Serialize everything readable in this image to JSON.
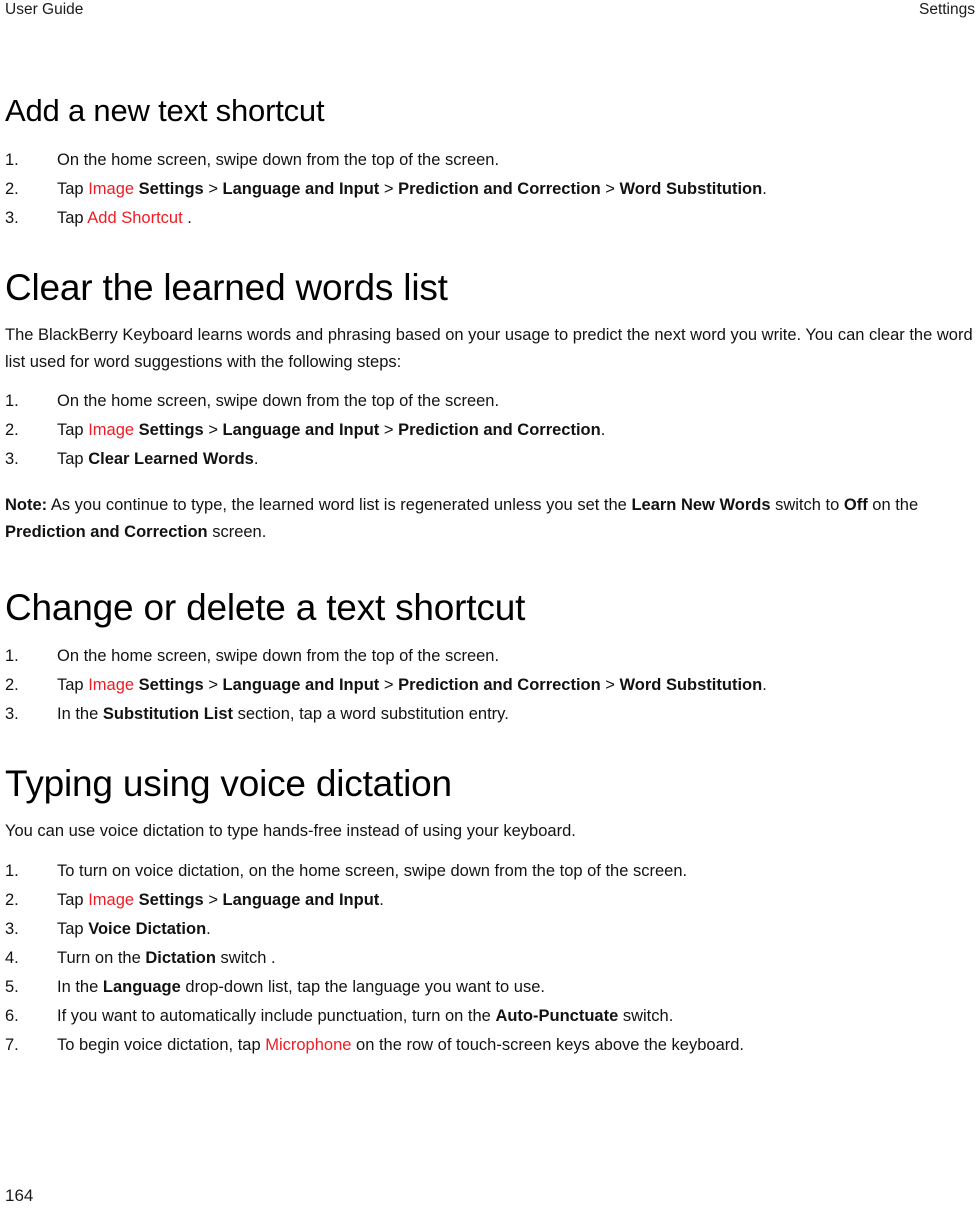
{
  "header": {
    "left": "User Guide",
    "right": "Settings"
  },
  "footer": {
    "page_number": "164"
  },
  "colors": {
    "link_red": "#ee1c25",
    "text": "#121212",
    "background": "#ffffff"
  },
  "sections": [
    {
      "id": "add-a-new-text-shortcut",
      "title": "Add a new text shortcut",
      "steps": [
        {
          "number": "1.",
          "parts": [
            {
              "text": "On the home screen, swipe down from the top of the screen.",
              "style": "normal"
            }
          ]
        },
        {
          "number": "2.",
          "parts": [
            {
              "text": "Tap ",
              "style": "normal"
            },
            {
              "text": "Image",
              "style": "red"
            },
            {
              "text": " ",
              "style": "normal"
            },
            {
              "text": "Settings",
              "style": "bold"
            },
            {
              "text": " > ",
              "style": "normal"
            },
            {
              "text": "Language and Input",
              "style": "bold"
            },
            {
              "text": " > ",
              "style": "normal"
            },
            {
              "text": "Prediction and Correction",
              "style": "bold"
            },
            {
              "text": " > ",
              "style": "normal"
            },
            {
              "text": "Word Substitution",
              "style": "bold"
            },
            {
              "text": ".",
              "style": "normal"
            }
          ]
        },
        {
          "number": "3.",
          "parts": [
            {
              "text": "Tap ",
              "style": "normal"
            },
            {
              "text": "Add Shortcut",
              "style": "red"
            },
            {
              "text": " .",
              "style": "normal"
            }
          ]
        }
      ]
    },
    {
      "id": "clear-the-learned-words-list",
      "title": "Clear the learned words list",
      "intro": "The BlackBerry Keyboard learns words and phrasing based on your usage to predict the next word you write. You can clear the word list used for word suggestions with the following steps:",
      "steps": [
        {
          "number": "1.",
          "parts": [
            {
              "text": "On the home screen, swipe down from the top of the screen.",
              "style": "normal"
            }
          ]
        },
        {
          "number": "2.",
          "parts": [
            {
              "text": "Tap ",
              "style": "normal"
            },
            {
              "text": "Image",
              "style": "red"
            },
            {
              "text": " ",
              "style": "normal"
            },
            {
              "text": "Settings",
              "style": "bold"
            },
            {
              "text": " > ",
              "style": "normal"
            },
            {
              "text": "Language and Input",
              "style": "bold"
            },
            {
              "text": " > ",
              "style": "normal"
            },
            {
              "text": "Prediction and Correction",
              "style": "bold"
            },
            {
              "text": ".",
              "style": "normal"
            }
          ]
        },
        {
          "number": "3.",
          "parts": [
            {
              "text": "Tap ",
              "style": "normal"
            },
            {
              "text": "Clear Learned Words",
              "style": "bold"
            },
            {
              "text": ".",
              "style": "normal"
            }
          ]
        }
      ],
      "note": [
        {
          "text": "Note:",
          "style": "bold"
        },
        {
          "text": " As you continue to type, the learned word list is regenerated unless you set the ",
          "style": "normal"
        },
        {
          "text": "Learn New Words",
          "style": "bold"
        },
        {
          "text": " switch to ",
          "style": "normal"
        },
        {
          "text": "Off",
          "style": "bold"
        },
        {
          "text": " on the ",
          "style": "normal"
        },
        {
          "text": "Prediction and Correction",
          "style": "bold"
        },
        {
          "text": " screen.",
          "style": "normal"
        }
      ]
    },
    {
      "id": "change-or-delete-a-text-shortcut",
      "title": "Change or delete a text shortcut",
      "steps": [
        {
          "number": "1.",
          "parts": [
            {
              "text": "On the home screen, swipe down from the top of the screen.",
              "style": "normal"
            }
          ]
        },
        {
          "number": "2.",
          "parts": [
            {
              "text": "Tap ",
              "style": "normal"
            },
            {
              "text": "Image",
              "style": "red"
            },
            {
              "text": " ",
              "style": "normal"
            },
            {
              "text": "Settings",
              "style": "bold"
            },
            {
              "text": " > ",
              "style": "normal"
            },
            {
              "text": "Language and Input",
              "style": "bold"
            },
            {
              "text": " > ",
              "style": "normal"
            },
            {
              "text": "Prediction and Correction",
              "style": "bold"
            },
            {
              "text": " > ",
              "style": "normal"
            },
            {
              "text": "Word Substitution",
              "style": "bold"
            },
            {
              "text": ".",
              "style": "normal"
            }
          ]
        },
        {
          "number": "3.",
          "parts": [
            {
              "text": "In the ",
              "style": "normal"
            },
            {
              "text": "Substitution List",
              "style": "bold"
            },
            {
              "text": " section, tap a word substitution entry.",
              "style": "normal"
            }
          ]
        }
      ]
    },
    {
      "id": "typing-using-voice-dictation",
      "title": "Typing using voice dictation",
      "intro": "You can use voice dictation to type hands-free instead of using your keyboard.",
      "steps": [
        {
          "number": "1.",
          "parts": [
            {
              "text": "To turn on voice dictation, on the home screen, swipe down from the top of the screen.",
              "style": "normal"
            }
          ]
        },
        {
          "number": "2.",
          "parts": [
            {
              "text": "Tap ",
              "style": "normal"
            },
            {
              "text": "Image",
              "style": "red"
            },
            {
              "text": " ",
              "style": "normal"
            },
            {
              "text": "Settings",
              "style": "bold"
            },
            {
              "text": " > ",
              "style": "normal"
            },
            {
              "text": "Language and Input",
              "style": "bold"
            },
            {
              "text": ".",
              "style": "normal"
            }
          ]
        },
        {
          "number": "3.",
          "parts": [
            {
              "text": "Tap ",
              "style": "normal"
            },
            {
              "text": "Voice Dictation",
              "style": "bold"
            },
            {
              "text": ".",
              "style": "normal"
            }
          ]
        },
        {
          "number": "4.",
          "parts": [
            {
              "text": "Turn on the ",
              "style": "normal"
            },
            {
              "text": "Dictation",
              "style": "bold"
            },
            {
              "text": " switch .",
              "style": "normal"
            }
          ]
        },
        {
          "number": "5.",
          "parts": [
            {
              "text": "In the ",
              "style": "normal"
            },
            {
              "text": "Language",
              "style": "bold"
            },
            {
              "text": " drop-down list, tap the language you want to use.",
              "style": "normal"
            }
          ]
        },
        {
          "number": "6.",
          "parts": [
            {
              "text": "If you want to automatically include punctuation, turn on the ",
              "style": "normal"
            },
            {
              "text": "Auto-Punctuate",
              "style": "bold"
            },
            {
              "text": " switch.",
              "style": "normal"
            }
          ]
        },
        {
          "number": "7.",
          "parts": [
            {
              "text": "To begin voice dictation, tap ",
              "style": "normal"
            },
            {
              "text": "Microphone",
              "style": "red"
            },
            {
              "text": "  on the row of touch-screen keys above the keyboard.",
              "style": "normal"
            }
          ]
        }
      ]
    }
  ]
}
